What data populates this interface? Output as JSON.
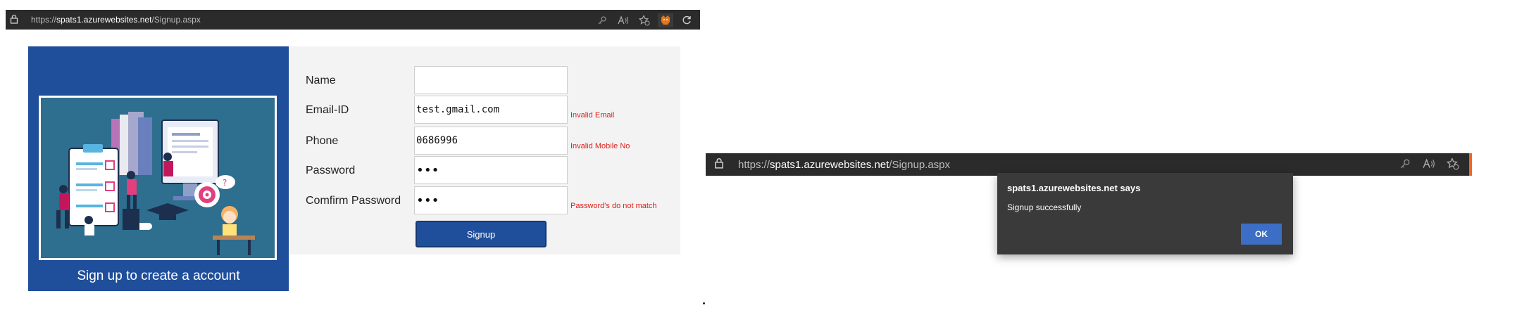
{
  "browser_left": {
    "url_prefix": "https://",
    "url_host": "spats1.azurewebsites.net",
    "url_path": "/Signup.aspx",
    "icons": [
      "lock-icon",
      "key-icon",
      "read-aloud-icon",
      "favorite-icon",
      "extension-icon",
      "refresh-icon"
    ]
  },
  "signup_page": {
    "caption": "Sign up to create a account",
    "fields": {
      "name": {
        "label": "Name",
        "value": ""
      },
      "email": {
        "label": "Email-ID",
        "value": "test.gmail.com",
        "error": "Invalid Email"
      },
      "phone": {
        "label": "Phone",
        "value": "0686996",
        "error": "Invalid Mobile No"
      },
      "password": {
        "label": "Password",
        "value": "•••"
      },
      "confirm": {
        "label": "Comfirm Password",
        "value": "•••",
        "error": "Password's do not match"
      }
    },
    "signup_label": "Signup"
  },
  "browser_right": {
    "url_prefix": "https://",
    "url_host": "spats1.azurewebsites.net",
    "url_path": "/Signup.aspx"
  },
  "dialog": {
    "title": "spats1.azurewebsites.net says",
    "message": "Signup successfully",
    "ok_label": "OK"
  },
  "colors": {
    "accent": "#1f4e9b",
    "error": "#e0201c",
    "dialog_bg": "#3a3a3a",
    "ok_button": "#3b6ec4"
  }
}
